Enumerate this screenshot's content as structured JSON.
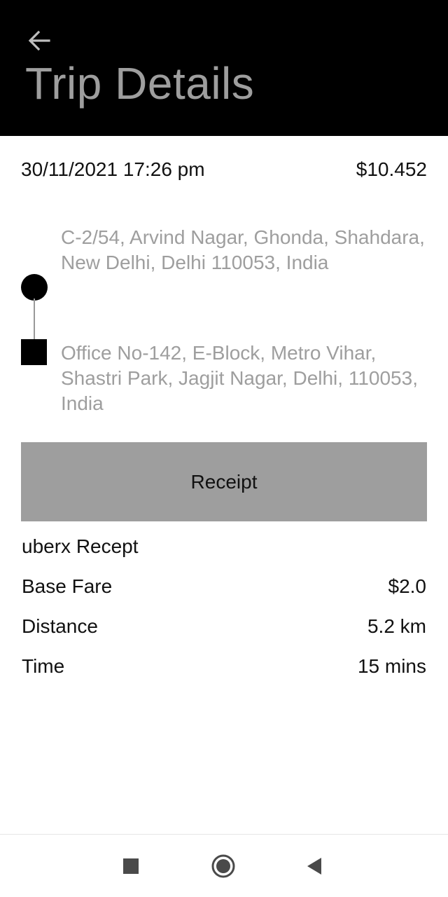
{
  "header": {
    "title": "Trip Details",
    "back_icon": "arrow-left-icon"
  },
  "trip": {
    "datetime": "30/11/2021 17:26 pm",
    "total": "$10.452"
  },
  "route": {
    "pickup_address": "C-2/54, Arvind Nagar, Ghonda, Shahdara, New Delhi, Delhi 110053, India",
    "dropoff_address": "Office No-142, E-Block, Metro Vihar, Shastri Park, Jagjit Nagar, Delhi, 110053, India"
  },
  "receipt": {
    "button_label": "Receipt",
    "title": "uberx Recept",
    "rows": [
      {
        "label": "Base Fare",
        "value": "$2.0"
      },
      {
        "label": "Distance",
        "value": "5.2 km"
      },
      {
        "label": "Time",
        "value": "15 mins"
      }
    ]
  },
  "nav_bar": {
    "icons": [
      "recent-apps-icon",
      "home-icon",
      "back-triangle-icon"
    ]
  },
  "colors": {
    "header_bg": "#000000",
    "title_text": "#9e9e9e",
    "address_text": "#9e9e9e",
    "receipt_button_bg": "#9e9e9e",
    "body_text": "#111111"
  }
}
